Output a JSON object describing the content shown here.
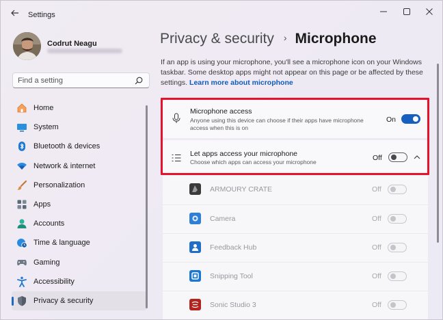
{
  "window": {
    "title": "Settings"
  },
  "user": {
    "name": "Codrut Neagu"
  },
  "search": {
    "placeholder": "Find a setting"
  },
  "sidebar": {
    "items": [
      {
        "label": "Home",
        "icon": "home-icon"
      },
      {
        "label": "System",
        "icon": "system-icon"
      },
      {
        "label": "Bluetooth & devices",
        "icon": "bluetooth-icon"
      },
      {
        "label": "Network & internet",
        "icon": "wifi-icon"
      },
      {
        "label": "Personalization",
        "icon": "brush-icon"
      },
      {
        "label": "Apps",
        "icon": "apps-icon"
      },
      {
        "label": "Accounts",
        "icon": "accounts-icon"
      },
      {
        "label": "Time & language",
        "icon": "globe-clock-icon"
      },
      {
        "label": "Gaming",
        "icon": "gamepad-icon"
      },
      {
        "label": "Accessibility",
        "icon": "accessibility-icon"
      },
      {
        "label": "Privacy & security",
        "icon": "shield-icon",
        "active": true
      }
    ]
  },
  "breadcrumb": {
    "parent": "Privacy & security",
    "separator": "›",
    "current": "Microphone"
  },
  "description": {
    "text": "If an app is using your microphone, you'll see a microphone icon on your Windows taskbar. Some desktop apps might not appear on this page or be affected by these settings.",
    "link": "Learn more about microphone"
  },
  "mic_access": {
    "title": "Microphone access",
    "subtitle": "Anyone using this device can choose if their apps have microphone access when this is on",
    "state": "On"
  },
  "apps_access": {
    "title": "Let apps access your microphone",
    "subtitle": "Choose which apps can access your microphone",
    "state": "Off"
  },
  "apps": [
    {
      "name": "ARMOURY CRATE",
      "state": "Off",
      "color": "#3a3a3a"
    },
    {
      "name": "Camera",
      "state": "Off",
      "color": "#2f7fd6"
    },
    {
      "name": "Feedback Hub",
      "state": "Off",
      "color": "#1f6fc9"
    },
    {
      "name": "Snipping Tool",
      "state": "Off",
      "color": "#1a78d0"
    },
    {
      "name": "Sonic Studio 3",
      "state": "Off",
      "color": "#b2241d"
    }
  ],
  "colors": {
    "accent": "#1760c0",
    "highlight": "#e6112b"
  }
}
